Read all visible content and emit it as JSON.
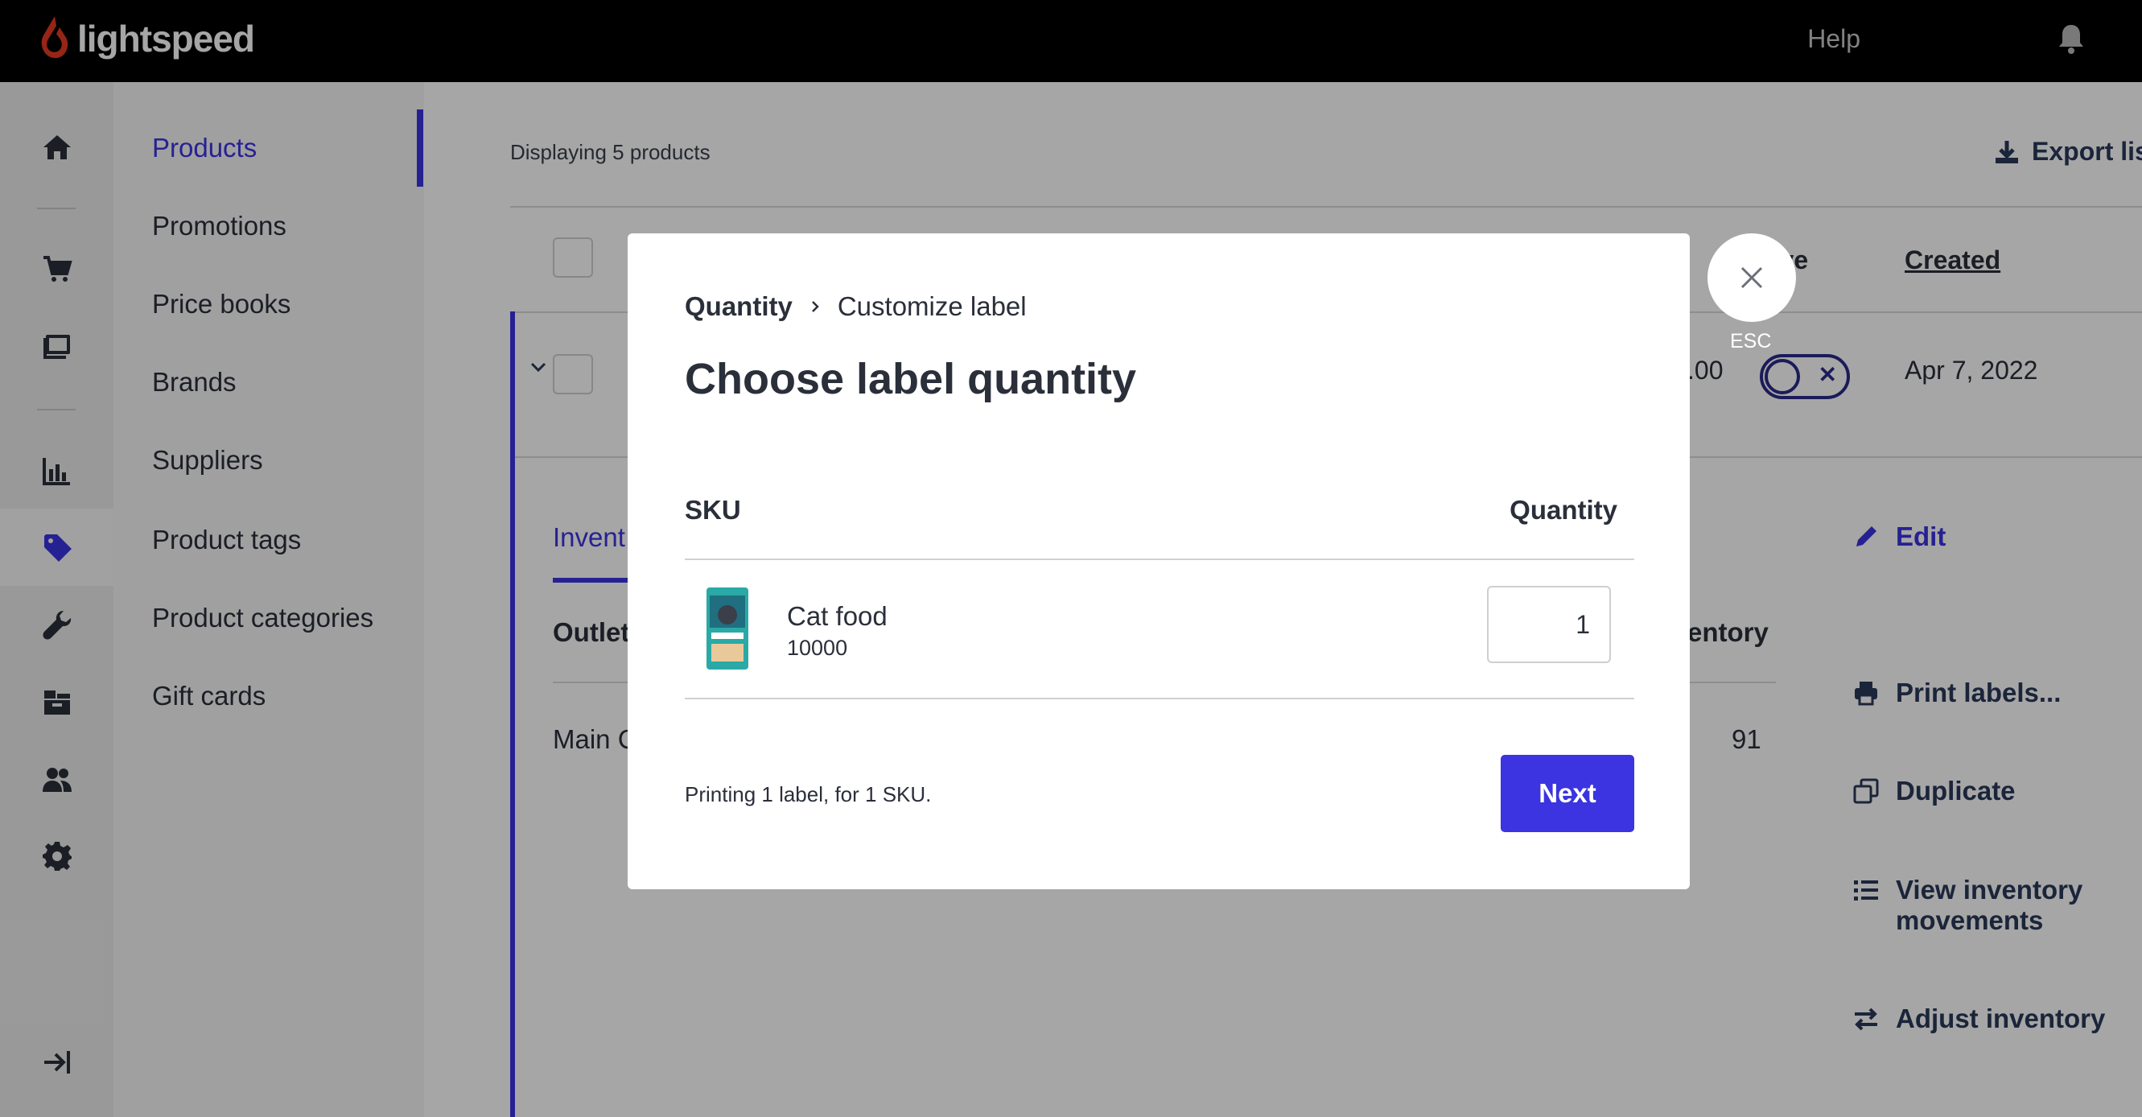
{
  "topbar": {
    "brand": "lightspeed",
    "help": "Help",
    "brand_color": "#e53a23"
  },
  "rail": {
    "icons": [
      "home-icon",
      "cart-icon",
      "register-icon",
      "reports-icon",
      "tag-icon",
      "wrench-icon",
      "inventory-icon",
      "customers-icon",
      "settings-icon",
      "collapse-icon"
    ],
    "active": "tag-icon"
  },
  "subnav": {
    "items": [
      {
        "label": "Products"
      },
      {
        "label": "Promotions"
      },
      {
        "label": "Price books"
      },
      {
        "label": "Brands"
      },
      {
        "label": "Suppliers"
      },
      {
        "label": "Product tags"
      },
      {
        "label": "Product categories"
      },
      {
        "label": "Gift cards"
      }
    ],
    "active_index": 0
  },
  "main": {
    "displaying": "Displaying 5 products",
    "export": "Export lis",
    "col_active": "tive",
    "col_created": "Created",
    "row_price": ".00",
    "row_date": "Apr 7, 2022",
    "inventory_tab": "Invent",
    "outlet_head": "Outlet",
    "inventory_head": "entory",
    "outlet_value": "Main C",
    "inventory_value": "91",
    "actions": [
      {
        "label": "Edit"
      },
      {
        "label": "Print labels..."
      },
      {
        "label": "Duplicate"
      },
      {
        "label": "View inventory movements"
      },
      {
        "label": "Adjust inventory"
      }
    ]
  },
  "modal": {
    "breadcrumb_current": "Quantity",
    "breadcrumb_next": "Customize label",
    "title": "Choose label quantity",
    "col_sku": "SKU",
    "col_quantity": "Quantity",
    "product_name": "Cat food",
    "product_sku": "10000",
    "quantity": "1",
    "summary": "Printing 1 label, for 1 SKU.",
    "next": "Next",
    "esc": "ESC"
  }
}
